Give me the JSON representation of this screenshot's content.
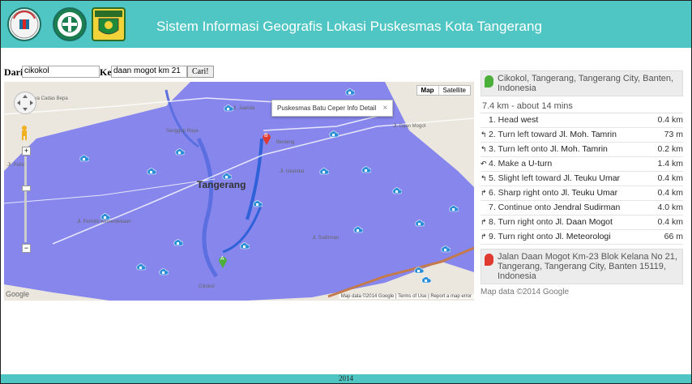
{
  "header": {
    "title": "Sistem Informasi Geografis Lokasi Puskesmas Kota Tangerang",
    "logo1_text": "STMIK RAHARJA",
    "logo3_text": "KOTA TANGERANG",
    "bg_color": "#4fc6c4"
  },
  "form": {
    "from_label": "Dari",
    "from_value": "cikokol",
    "to_label": "Ke",
    "to_value": "daan mogot km 21",
    "submit_label": "Cari!"
  },
  "map": {
    "type_map": "Map",
    "type_satellite": "Satellite",
    "city_label": "Tangerang",
    "info_window": "Puskesmas Batu Ceper Info Detail",
    "close_glyph": "×",
    "marker_a": "A",
    "marker_b": "B",
    "attribution": "Map data ©2014 Google",
    "terms": "Terms of Use",
    "report": "Report a map error",
    "google": "Google",
    "road_labels": [
      "Raya Cadas Bepa",
      "Jl. Juanda",
      "Jl. Daan Mogot",
      "Jl. Perintis Kemerdekaan",
      "Jl. Pelita",
      "Sanggup Raya",
      "Jl. Iskandar",
      "Benteng",
      "Jl. Sudirman",
      "Cikokol"
    ],
    "accent_area": "#7b7bee",
    "route_color": "#3a6ee0"
  },
  "directions": {
    "start_marker": "A",
    "start_address": "Cikokol, Tangerang, Tangerang City, Banten, Indonesia",
    "summary": "7.4 km - about 14 mins",
    "steps": [
      {
        "icon": "",
        "text": "1. Head ",
        "bold": "west",
        "dist": "0.4 km"
      },
      {
        "icon": "↰",
        "text": "2. Turn left toward ",
        "bold": "Jl. Moh. Tamrin",
        "dist": "73 m"
      },
      {
        "icon": "↰",
        "text": "3. Turn left onto ",
        "bold": "Jl. Moh. Tamrin",
        "dist": "0.2 km"
      },
      {
        "icon": "↶",
        "text": "4. Make a ",
        "bold": "U-turn",
        "dist": "1.4 km"
      },
      {
        "icon": "↰",
        "text": "5. Slight left toward ",
        "bold": "Jl. Teuku Umar",
        "dist": "0.4 km"
      },
      {
        "icon": "↱",
        "text": "6. Sharp right onto ",
        "bold": "Jl. Teuku Umar",
        "dist": "0.4 km"
      },
      {
        "icon": "",
        "text": "7. Continue onto ",
        "bold": "Jendral Sudirman",
        "dist": "4.0 km"
      },
      {
        "icon": "↱",
        "text": "8. Turn right onto ",
        "bold": "Jl. Daan Mogot",
        "dist": "0.4 km"
      },
      {
        "icon": "↱",
        "text": "9. Turn right onto ",
        "bold": "Jl. Meteorologi",
        "dist": "66 m"
      }
    ],
    "end_marker": "B",
    "end_address": "Jalan Daan Mogot Km-23 Blok Kelana No 21, Tangerang, Tangerang City, Banten 15119, Indonesia",
    "copyright": "Map data ©2014 Google"
  },
  "footer": {
    "text": "2014"
  }
}
